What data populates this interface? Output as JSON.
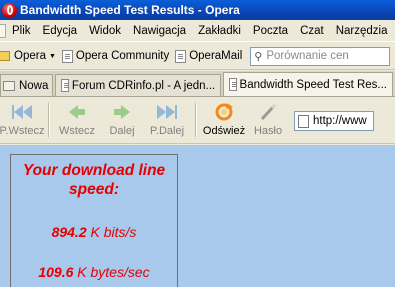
{
  "window": {
    "title": "Bandwidth Speed Test Results - Opera"
  },
  "menu": {
    "items": [
      "Plik",
      "Edycja",
      "Widok",
      "Nawigacja",
      "Zakładki",
      "Poczta",
      "Czat",
      "Narzędzia"
    ]
  },
  "personal_bar": {
    "opera_label": "Opera",
    "community_label": "Opera Community",
    "mail_label": "OperaMail",
    "search_placeholder": "Porównanie cen"
  },
  "tabs": {
    "new_label": "Nowa",
    "items": [
      {
        "label": "Forum CDRinfo.pl - A jedn..."
      },
      {
        "label": "Bandwidth Speed Test Res..."
      }
    ]
  },
  "navigation": {
    "rewind": "P.Wstecz",
    "back": "Wstecz",
    "forward": "Dalej",
    "fast_forward": "P.Dalej",
    "reload": "Odśwież",
    "wand": "Hasło",
    "address": "http://www"
  },
  "result": {
    "headline_1": "Your download line",
    "headline_2": "speed:",
    "kbits_value": "894.2",
    "kbits_unit": " K bits/s",
    "kbytes_value": "109.6",
    "kbytes_unit": " K bytes/sec"
  },
  "colors": {
    "content_background": "#a8c8ec",
    "result_text": "#e60000",
    "titlebar": "#0b47b8"
  }
}
